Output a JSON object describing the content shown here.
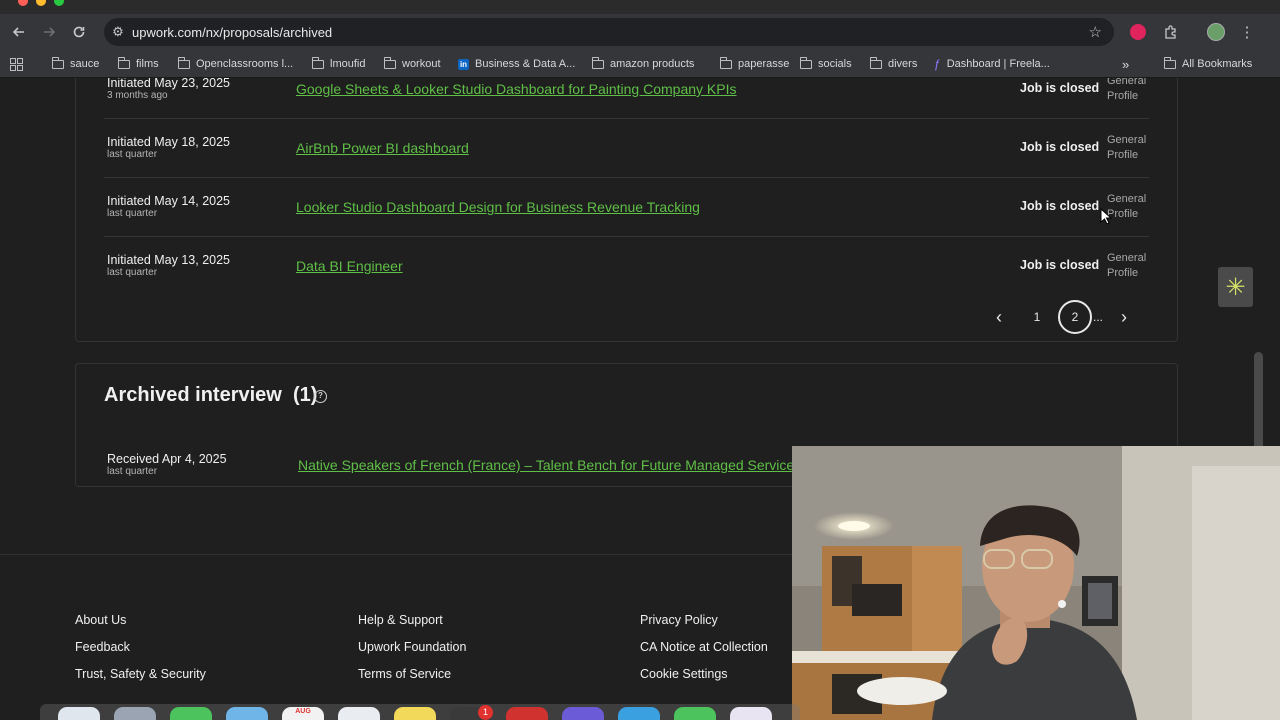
{
  "browser": {
    "url": "upwork.com/nx/proposals/archived",
    "bookmarks": [
      {
        "label": "sauce",
        "icon": "folder-icon"
      },
      {
        "label": "films",
        "icon": "folder-icon"
      },
      {
        "label": "Openclassrooms l...",
        "icon": "folder-icon"
      },
      {
        "label": "lmoufid",
        "icon": "folder-icon"
      },
      {
        "label": "workout",
        "icon": "folder-icon"
      },
      {
        "label": "Business & Data A...",
        "icon": "linkedin-icon"
      },
      {
        "label": "amazon products",
        "icon": "folder-icon"
      },
      {
        "label": "paperasse",
        "icon": "folder-icon"
      },
      {
        "label": "socials",
        "icon": "folder-icon"
      },
      {
        "label": "divers",
        "icon": "folder-icon"
      },
      {
        "label": "Dashboard | Freela...",
        "icon": "upwork-icon"
      }
    ],
    "all_bookmarks": "All Bookmarks",
    "more_glyph": "»"
  },
  "proposals": {
    "rows": [
      {
        "date": "Initiated May 23, 2025",
        "sub": "3 months ago",
        "title": "Google Sheets & Looker Studio Dashboard for Painting Company KPIs",
        "status": "Job is closed",
        "profile_line1": "General",
        "profile_line2": "Profile"
      },
      {
        "date": "Initiated May 18, 2025",
        "sub": "last quarter",
        "title": "AirBnb Power BI dashboard",
        "status": "Job is closed",
        "profile_line1": "General",
        "profile_line2": "Profile"
      },
      {
        "date": "Initiated May 14, 2025",
        "sub": "last quarter",
        "title": "Looker Studio Dashboard Design for Business Revenue Tracking",
        "status": "Job is closed",
        "profile_line1": "General",
        "profile_line2": "Profile"
      },
      {
        "date": "Initiated May 13, 2025",
        "sub": "last quarter",
        "title": "Data BI Engineer",
        "status": "Job is closed",
        "profile_line1": "General",
        "profile_line2": "Profile"
      }
    ],
    "pagination": {
      "prev": "‹",
      "page1": "1",
      "page2": "2",
      "ellipsis": "...",
      "next": "›",
      "current": 2
    }
  },
  "archived_interview": {
    "title": "Archived interview",
    "count": "(1)",
    "help": "?",
    "rows": [
      {
        "date": "Received Apr 4, 2025",
        "sub": "last quarter",
        "title": "Native Speakers of French (France) – Talent Bench for Future Managed Service"
      }
    ]
  },
  "footer": {
    "col1": [
      "About Us",
      "Feedback",
      "Trust, Safety & Security"
    ],
    "col2": [
      "Help & Support",
      "Upwork Foundation",
      "Terms of Service"
    ],
    "col3": [
      "Privacy Policy",
      "CA Notice at Collection",
      "Cookie Settings"
    ]
  },
  "dock": {
    "badge": "1",
    "calendar_month": "AUG"
  },
  "colors": {
    "link_green": "#5fbf46",
    "background": "#1f1f1f"
  }
}
